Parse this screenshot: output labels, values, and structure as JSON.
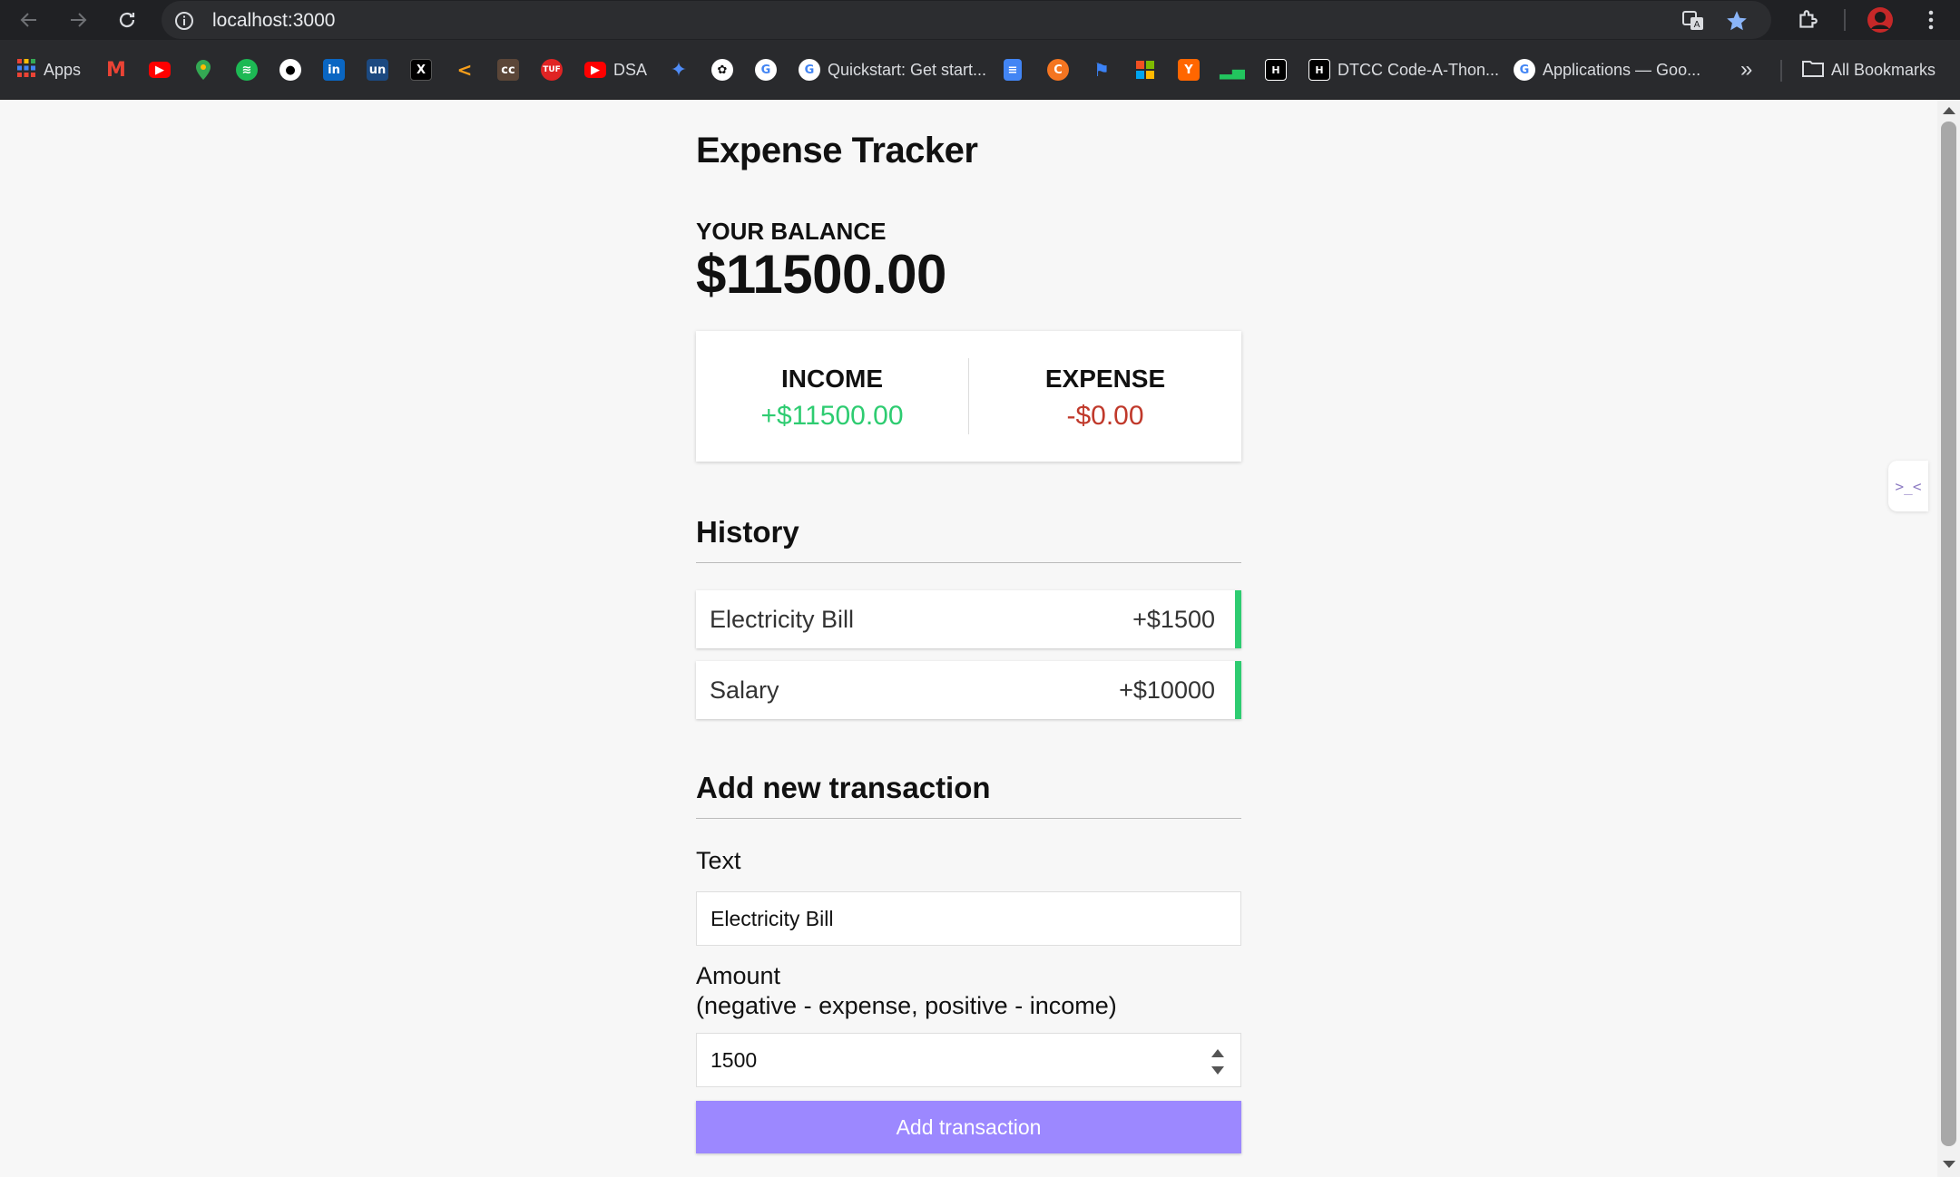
{
  "browser": {
    "url": "localhost:3000",
    "bookmarks": [
      {
        "label": "Apps",
        "icon": "apps-grid-icon",
        "color": "#4285f4"
      },
      {
        "label": "",
        "icon": "gmail-icon",
        "color": "#ea4335"
      },
      {
        "label": "",
        "icon": "youtube-icon",
        "color": "#ff0000"
      },
      {
        "label": "",
        "icon": "google-maps-icon",
        "color": "#34a853"
      },
      {
        "label": "",
        "icon": "spotify-icon",
        "color": "#1db954"
      },
      {
        "label": "",
        "icon": "github-icon",
        "color": "#ffffff"
      },
      {
        "label": "",
        "icon": "linkedin-icon",
        "color": "#0a66c2"
      },
      {
        "label": "",
        "icon": "unstop-icon",
        "color": "#1c4980"
      },
      {
        "label": "",
        "icon": "x-twitter-icon",
        "color": "#000000"
      },
      {
        "label": "",
        "icon": "leetcode-icon",
        "color": "#f89f1b"
      },
      {
        "label": "",
        "icon": "codechef-icon",
        "color": "#5b4638"
      },
      {
        "label": "",
        "icon": "tuf-icon",
        "color": "#e02424"
      },
      {
        "label": "DSA",
        "icon": "youtube-icon",
        "color": "#ff0000"
      },
      {
        "label": "",
        "icon": "gemini-icon",
        "color": "#4f8cf7"
      },
      {
        "label": "",
        "icon": "chatgpt-icon",
        "color": "#ffffff"
      },
      {
        "label": "",
        "icon": "google-icon",
        "color": "#ffffff"
      },
      {
        "label": "Quickstart: Get start...",
        "icon": "google-icon",
        "color": "#ffffff"
      },
      {
        "label": "",
        "icon": "google-docs-icon",
        "color": "#4285f4"
      },
      {
        "label": "",
        "icon": "crunchyroll-icon",
        "color": "#f47521"
      },
      {
        "label": "",
        "icon": "flag-icon",
        "color": "#3b82f6"
      },
      {
        "label": "",
        "icon": "microsoft-icon",
        "color": "#f25022"
      },
      {
        "label": "",
        "icon": "ycombinator-icon",
        "color": "#ff6600"
      },
      {
        "label": "",
        "icon": "chart-bars-icon",
        "color": "#22c55e"
      },
      {
        "label": "",
        "icon": "hackerrank-icon",
        "color": "#000000"
      },
      {
        "label": "DTCC Code-A-Thon...",
        "icon": "hackerrank-icon",
        "color": "#000000"
      },
      {
        "label": "Applications — Goo...",
        "icon": "google-icon",
        "color": "#ffffff"
      }
    ],
    "all_bookmarks_label": "All Bookmarks",
    "more_glyph": "»"
  },
  "app": {
    "title": "Expense Tracker",
    "balance_label": "YOUR BALANCE",
    "balance_value": "$11500.00",
    "income_label": "INCOME",
    "income_value": "+$11500.00",
    "expense_label": "EXPENSE",
    "expense_value": "-$0.00",
    "history_title": "History",
    "history": [
      {
        "text": "Electricity Bill",
        "amount": "+$1500"
      },
      {
        "text": "Salary",
        "amount": "+$10000"
      }
    ],
    "add_title": "Add new transaction",
    "text_label": "Text",
    "text_value": "Electricity Bill",
    "amount_label_line1": "Amount",
    "amount_label_line2": "(negative - expense, positive - income)",
    "amount_value": "1500",
    "button_label": "Add transaction"
  },
  "colors": {
    "income": "#2ecc71",
    "expense": "#c0392b",
    "button": "#9c88ff"
  }
}
